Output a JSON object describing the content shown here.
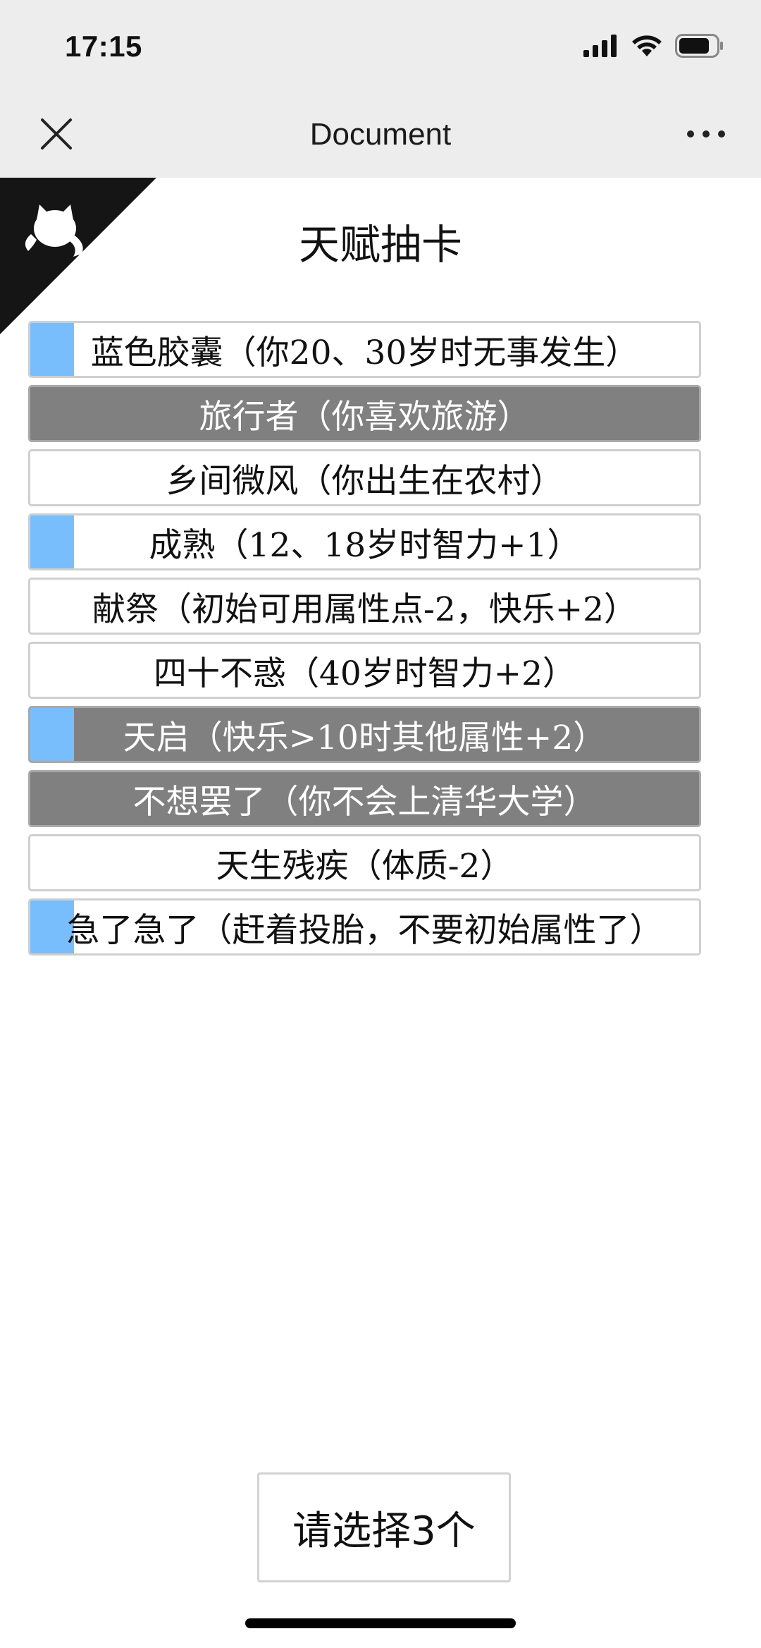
{
  "status_bar": {
    "time": "17:15",
    "icons": [
      "signal-icon",
      "wifi-icon",
      "battery-icon"
    ]
  },
  "nav": {
    "title": "Document",
    "close_icon": "close-icon",
    "more_icon": "more-icon"
  },
  "corner_icon": "github-cat-icon",
  "page_title": "天赋抽卡",
  "talents": [
    {
      "label": "蓝色胶囊（你20、30岁时无事发生）",
      "grade_marker": true,
      "selected": false
    },
    {
      "label": "旅行者（你喜欢旅游）",
      "grade_marker": false,
      "selected": true
    },
    {
      "label": "乡间微风（你出生在农村）",
      "grade_marker": false,
      "selected": false
    },
    {
      "label": "成熟（12、18岁时智力+1）",
      "grade_marker": true,
      "selected": false
    },
    {
      "label": "献祭（初始可用属性点-2，快乐+2）",
      "grade_marker": false,
      "selected": false
    },
    {
      "label": "四十不惑（40岁时智力+2）",
      "grade_marker": false,
      "selected": false
    },
    {
      "label": "天启（快乐>10时其他属性+2）",
      "grade_marker": true,
      "selected": true
    },
    {
      "label": "不想罢了（你不会上清华大学）",
      "grade_marker": false,
      "selected": true
    },
    {
      "label": "天生残疾（体质-2）",
      "grade_marker": false,
      "selected": false
    },
    {
      "label": "急了急了（赶着投胎，不要初始属性了）",
      "grade_marker": true,
      "selected": false
    }
  ],
  "confirm_button": {
    "label": "请选择3个"
  },
  "colors": {
    "grade_marker": "#78bdfc",
    "selected_bg": "#808080",
    "bar_bg": "#ededed"
  }
}
